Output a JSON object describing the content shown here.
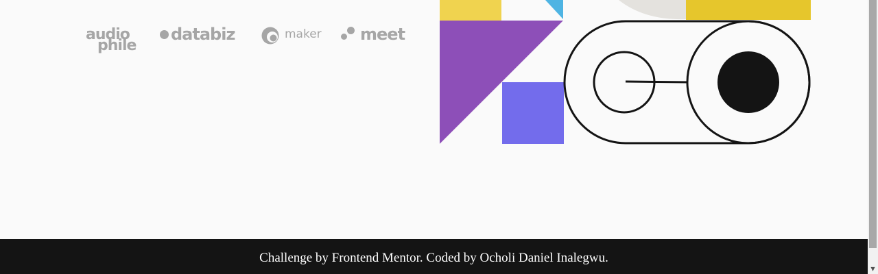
{
  "brand_logos": [
    {
      "line1": "audio",
      "line2": "phile"
    },
    {
      "name": "databiz"
    },
    {
      "name": "maker"
    },
    {
      "name": "meet"
    }
  ],
  "colors": {
    "yellow": "#f0d34f",
    "cyan": "#4eb4e3",
    "purple": "#8d4fb8",
    "indigo": "#736cec",
    "dark": "#141414",
    "logo_gray": "#a6a6a6"
  },
  "footer": {
    "text": "Challenge by Frontend Mentor. Coded by Ocholi Daniel Inalegwu."
  },
  "scrollbar": {
    "down_arrow": "▼"
  }
}
